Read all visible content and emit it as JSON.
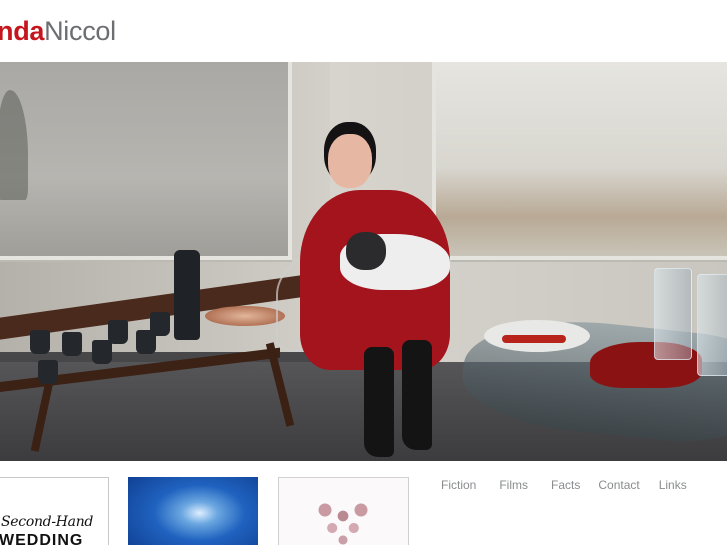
{
  "logo": {
    "first": "nda",
    "last": "Niccol"
  },
  "nav": {
    "items": [
      {
        "label": "Fiction"
      },
      {
        "label": "Films"
      },
      {
        "label": "Facts"
      },
      {
        "label": "Contact"
      },
      {
        "label": "Links"
      }
    ]
  },
  "thumbnails": [
    {
      "title_line1": "Second-Hand",
      "title_line2": "WEDDING"
    },
    {},
    {}
  ],
  "colors": {
    "brand_red": "#c4161c",
    "logo_grey": "#6d6e71",
    "nav_grey": "#8a8c8e"
  }
}
